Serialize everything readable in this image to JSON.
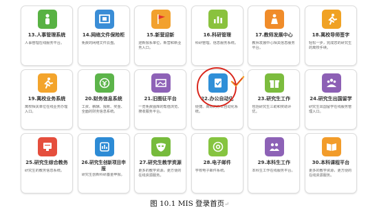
{
  "cards": [
    {
      "title": "13.人事管理系统",
      "desc": "人事管理在线服务平台。",
      "icon": "person-icon",
      "color": "#58b243"
    },
    {
      "title": "14.网络文件保险柜",
      "desc": "免费的网络文件云盘。",
      "icon": "safe-icon",
      "color": "#3a8dd6"
    },
    {
      "title": "15.新营迎新",
      "desc": "迎新报系单位，新营和新业务入口。",
      "icon": "flag-icon",
      "color": "#f2a12e"
    },
    {
      "title": "16.科研管理",
      "desc": "科研管理、信息服务系统。",
      "icon": "chart-icon",
      "color": "#8ac23e"
    },
    {
      "title": "17.教师发展中心",
      "desc": "教师发展中心相关信息服务平台。",
      "icon": "teacher-icon",
      "color": "#f08c2a"
    },
    {
      "title": "18.离校导师签字",
      "desc": "轻松一步，完成您的研究生的离校手续。",
      "icon": "runner-icon",
      "color": "#f0a224"
    },
    {
      "title": "19.离校业务系统",
      "desc": "离校相关单位在线业务办理入口。",
      "icon": "runner-icon",
      "color": "#f3a42c"
    },
    {
      "title": "20.财务信息系统",
      "desc": "工资、薪酬、报账、奖金、全面的财务信息系统。",
      "icon": "money-icon",
      "color": "#5cb44a"
    },
    {
      "title": "21.旧图征平台",
      "desc": "一览免费图库的帮值浏览、搜收服务平台。",
      "icon": "image-icon",
      "color": "#8e62b7"
    },
    {
      "title": "22.办公自动化",
      "desc": "便捷、高效的办公自动化系统。",
      "icon": "office-icon",
      "color": "#2f8fd8"
    },
    {
      "title": "23.研究生工作",
      "desc": "包括研究生三助和奖助评优。",
      "icon": "gift-icon",
      "color": "#7cbc3e"
    },
    {
      "title": "24.研究生出国留学",
      "desc": "研究生出国留学在线服务管理入口。",
      "icon": "group-icon",
      "color": "#8d60b5"
    },
    {
      "title": "25.研究生综合教务",
      "desc": "研究生的教务信息系统。",
      "icon": "screen-icon",
      "color": "#e54e3d"
    },
    {
      "title": "26.研究生创新项目申报",
      "desc": "研究生创新科研基金申报。",
      "icon": "innovation-icon",
      "color": "#2d8bd5"
    },
    {
      "title": "27.研究生教学资源",
      "desc": "更多的教学资源，更方便的在线资源服务。",
      "icon": "mask-icon",
      "color": "#77bb3c"
    },
    {
      "title": "28.电子邮件",
      "desc": "学校电子邮件系统。",
      "icon": "at-icon",
      "color": "#86c440"
    },
    {
      "title": "29.本科生工作",
      "desc": "本科生工作在线服务平台。",
      "icon": "people-icon",
      "color": "#8d62b6"
    },
    {
      "title": "30.本科课程平台",
      "desc": "更多的教学资源，更方便的在线资源服务。",
      "icon": "book-icon",
      "color": "#f29c2a"
    }
  ],
  "caption": {
    "text": "图 10.1    MIS 登录首页",
    "return_mark": "↵"
  }
}
